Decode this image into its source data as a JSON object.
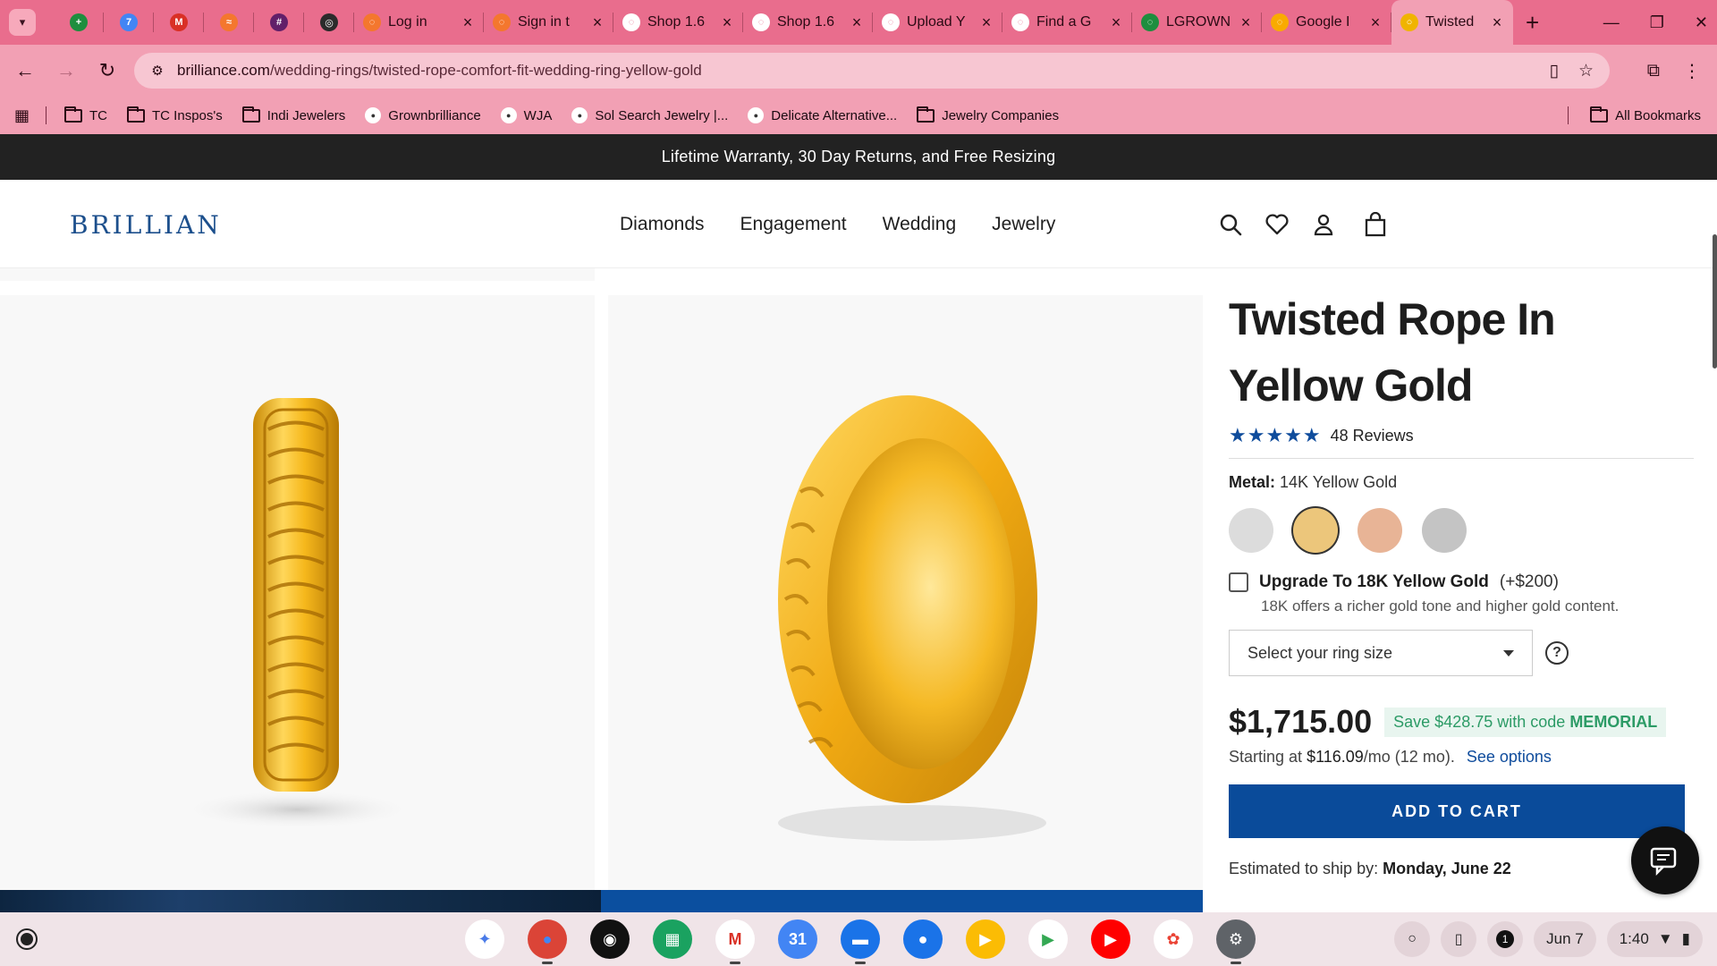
{
  "browser": {
    "pinned_tabs": [
      {
        "icon": "google-meet-icon",
        "color": "#1e8e3e",
        "glyph": "+"
      },
      {
        "icon": "calendar-7-icon",
        "color": "#4285f4",
        "glyph": "7"
      },
      {
        "icon": "gmail-icon",
        "color": "#d93025",
        "glyph": "M"
      },
      {
        "icon": "orange-swirl-icon",
        "color": "#f4772e",
        "glyph": "≈"
      },
      {
        "icon": "slack-icon",
        "color": "#611f69",
        "glyph": "#"
      },
      {
        "icon": "dark-circle-icon",
        "color": "#2b2b2b",
        "glyph": "◎"
      }
    ],
    "tabs": [
      {
        "title": "Log in",
        "icon": "orange-swirl-icon",
        "color": "#f4772e"
      },
      {
        "title": "Sign in t",
        "icon": "orange-swirl-icon",
        "color": "#f4772e"
      },
      {
        "title": "Shop 1.6",
        "icon": "gb-icon",
        "color": "#ffffff"
      },
      {
        "title": "Shop 1.6",
        "icon": "gb-icon",
        "color": "#ffffff"
      },
      {
        "title": "Upload Y",
        "icon": "gb-icon",
        "color": "#ffffff"
      },
      {
        "title": "Find a G",
        "icon": "gb-icon",
        "color": "#ffffff"
      },
      {
        "title": "LGROWN",
        "icon": "google-sheets-icon",
        "color": "#1e8e3e"
      },
      {
        "title": "Google I",
        "icon": "google-meet-icon",
        "color": "#f9ab00"
      }
    ],
    "active_tab": {
      "title": "Twisted",
      "icon": "brilliance-ring-icon",
      "color": "#f0b400"
    },
    "url_domain": "brilliance.com",
    "url_path": "/wedding-rings/twisted-rope-comfort-fit-wedding-ring-yellow-gold",
    "bookmarks": [
      {
        "label": "TC",
        "type": "folder"
      },
      {
        "label": "TC Inspos's",
        "type": "folder"
      },
      {
        "label": "Indi Jewelers",
        "type": "folder"
      },
      {
        "label": "Grownbrilliance",
        "type": "site"
      },
      {
        "label": "WJA",
        "type": "site"
      },
      {
        "label": "Sol Search Jewelry |...",
        "type": "site"
      },
      {
        "label": "Delicate Alternative...",
        "type": "site"
      },
      {
        "label": "Jewelry Companies",
        "type": "folder"
      }
    ],
    "all_bookmarks_label": "All Bookmarks"
  },
  "site": {
    "promo_banner": "Lifetime Warranty, 30 Day Returns, and Free Resizing",
    "logo": "BRILLIANCE",
    "nav": [
      "Diamonds",
      "Engagement",
      "Wedding",
      "Jewelry"
    ]
  },
  "product": {
    "title": "Twisted Rope In Yellow Gold",
    "stars": "★★★★★",
    "rating": 5,
    "reviews": "48 Reviews",
    "metal_label": "Metal:",
    "metal_value": "14K Yellow Gold",
    "swatches": [
      {
        "name": "white-gold",
        "color": "#dcdcdc"
      },
      {
        "name": "yellow-gold",
        "color": "#ecc67b",
        "selected": true
      },
      {
        "name": "rose-gold",
        "color": "#e8b496"
      },
      {
        "name": "platinum",
        "color": "#c4c4c4"
      }
    ],
    "upgrade_label": "Upgrade To 18K Yellow Gold",
    "upgrade_price": "(+$200)",
    "upgrade_note": "18K offers a richer gold tone and higher gold content.",
    "size_placeholder": "Select your ring size",
    "price": "$1,715.00",
    "save_text": "Save $428.75 with code",
    "save_code": "MEMORIAL",
    "finance_prefix": "Starting at",
    "finance_amount": "$116.09",
    "finance_suffix": "/mo (12 mo).",
    "see_options": "See options",
    "add_to_cart": "ADD TO CART",
    "ship_label": "Estimated to ship by:",
    "ship_date": "Monday, June 22"
  },
  "shelf": {
    "apps": [
      {
        "name": "gemini-icon",
        "color": "#ffffff",
        "glyph": "✦",
        "fg": "#4a7be8"
      },
      {
        "name": "chrome-icon",
        "color": "#db4437",
        "glyph": "●",
        "fg": "#4285f4",
        "running": true
      },
      {
        "name": "podcast-icon",
        "color": "#111111",
        "glyph": "◉",
        "fg": "#ffffff"
      },
      {
        "name": "app-grid-icon",
        "color": "#1aa260",
        "glyph": "▦",
        "fg": "#ffffff"
      },
      {
        "name": "gmail-icon",
        "color": "#ffffff",
        "glyph": "M",
        "fg": "#d93025",
        "running": true
      },
      {
        "name": "calendar-icon",
        "color": "#4285f4",
        "glyph": "31",
        "fg": "#ffffff"
      },
      {
        "name": "files-icon",
        "color": "#1a73e8",
        "glyph": "▬",
        "fg": "#ffffff",
        "running": true
      },
      {
        "name": "messages-icon",
        "color": "#1a73e8",
        "glyph": "●",
        "fg": "#ffffff"
      },
      {
        "name": "meet-icon",
        "color": "#fbbc04",
        "glyph": "▶",
        "fg": "#ffffff"
      },
      {
        "name": "play-store-icon",
        "color": "#ffffff",
        "glyph": "▶",
        "fg": "#34a853"
      },
      {
        "name": "youtube-icon",
        "color": "#ff0000",
        "glyph": "▶",
        "fg": "#ffffff"
      },
      {
        "name": "photos-icon",
        "color": "#ffffff",
        "glyph": "✿",
        "fg": "#ea4335"
      },
      {
        "name": "settings-icon",
        "color": "#5f6368",
        "glyph": "⚙",
        "fg": "#ffffff",
        "running": true
      }
    ],
    "date": "Jun 7",
    "time": "1:40",
    "notification_count": "1"
  }
}
